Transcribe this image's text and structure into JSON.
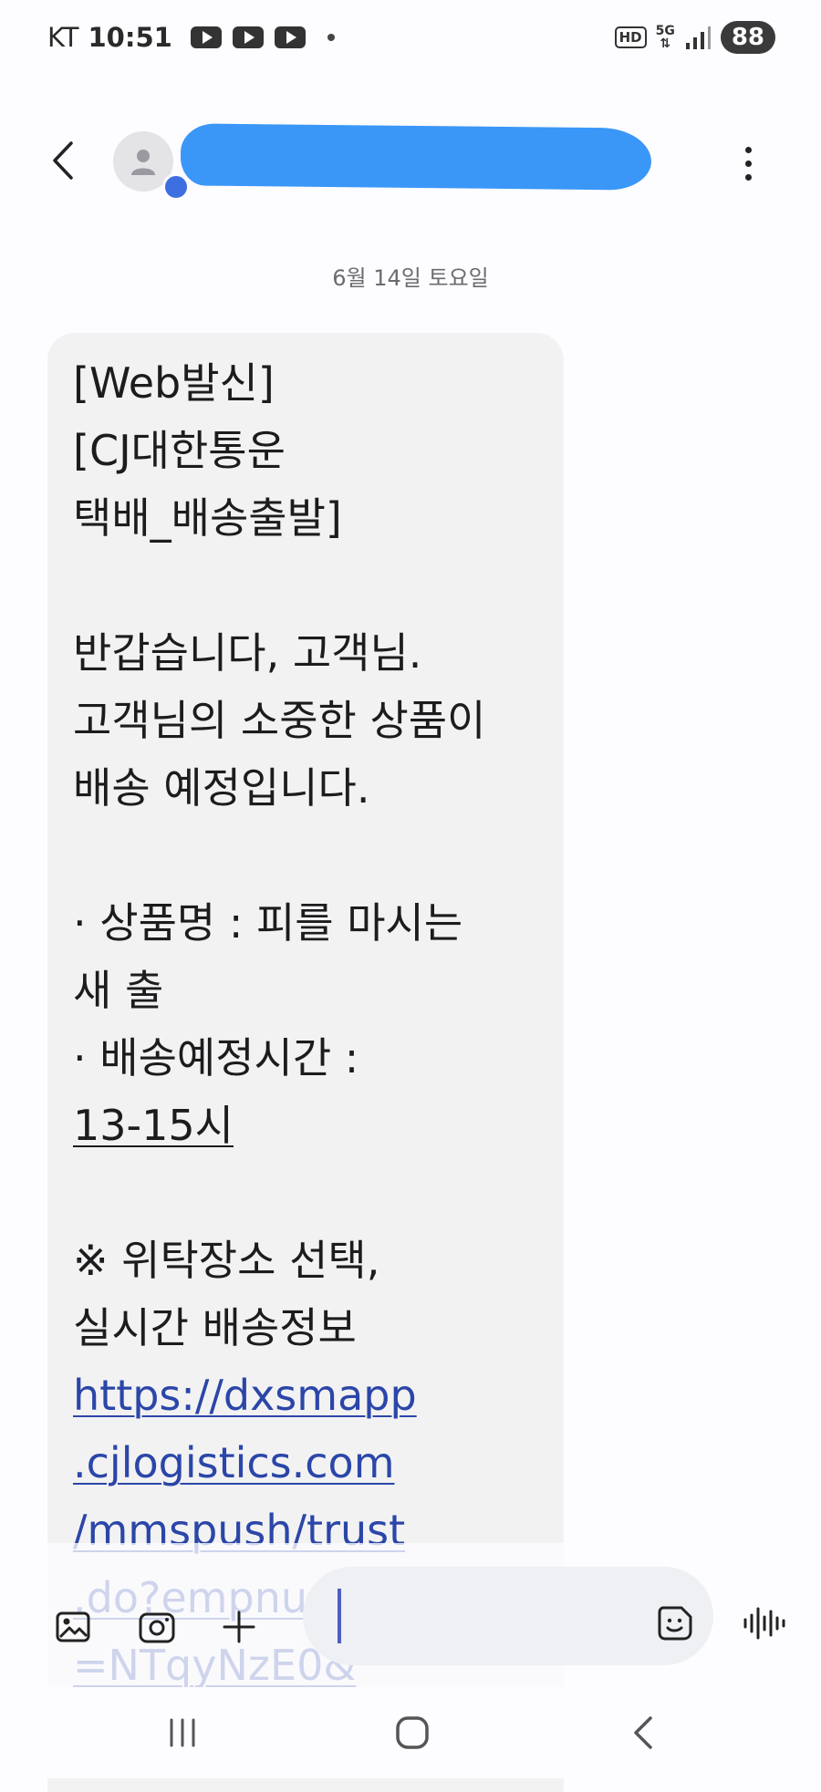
{
  "status_bar": {
    "carrier": "KT",
    "time": "10:51",
    "hd_label": "HD",
    "network_label": "5G",
    "battery": "88"
  },
  "header": {
    "contact_name": ""
  },
  "conversation": {
    "date": "6월 14일 토요일",
    "message": {
      "lines": [
        {
          "text": "[Web발신]",
          "style": "normal"
        },
        {
          "text": "[CJ대한통운",
          "style": "normal"
        },
        {
          "text": "택배_배송출발]",
          "style": "normal"
        },
        {
          "text": "",
          "style": "blank"
        },
        {
          "text": "반갑습니다, 고객님.",
          "style": "normal"
        },
        {
          "text": "고객님의 소중한 상품이",
          "style": "normal"
        },
        {
          "text": "배송 예정입니다.",
          "style": "normal"
        },
        {
          "text": "",
          "style": "blank"
        },
        {
          "text": " · 상품명 : 피를 마시는",
          "style": "normal"
        },
        {
          "text": "새 출",
          "style": "normal"
        },
        {
          "text": " · 배송예정시간 :",
          "style": "normal"
        },
        {
          "text": "13-15시",
          "style": "underline"
        },
        {
          "text": "",
          "style": "blank"
        },
        {
          "text": "※ 위탁장소 선택,",
          "style": "normal"
        },
        {
          "text": "실시간 배송정보",
          "style": "normal"
        },
        {
          "text": "https://dxsmapp",
          "style": "link"
        },
        {
          "text": ".cjlogistics.com",
          "style": "link"
        },
        {
          "text": "/mmspush/trust",
          "style": "link"
        },
        {
          "text": ".do?empnu",
          "style": "link"
        },
        {
          "text": "=NTqyNzE0&",
          "style": "link"
        }
      ]
    }
  },
  "composer": {
    "input_value": "",
    "icons": [
      "gallery-icon",
      "camera-icon",
      "add-icon",
      "sticker-icon",
      "voice-icon"
    ]
  },
  "navigation": {
    "icons": [
      "recents-icon",
      "home-icon",
      "back-icon"
    ]
  },
  "colors": {
    "accent": "#3d6fe0",
    "link": "#2b46a8",
    "bubble": "#f2f2f3",
    "redaction": "#3a97f7"
  }
}
